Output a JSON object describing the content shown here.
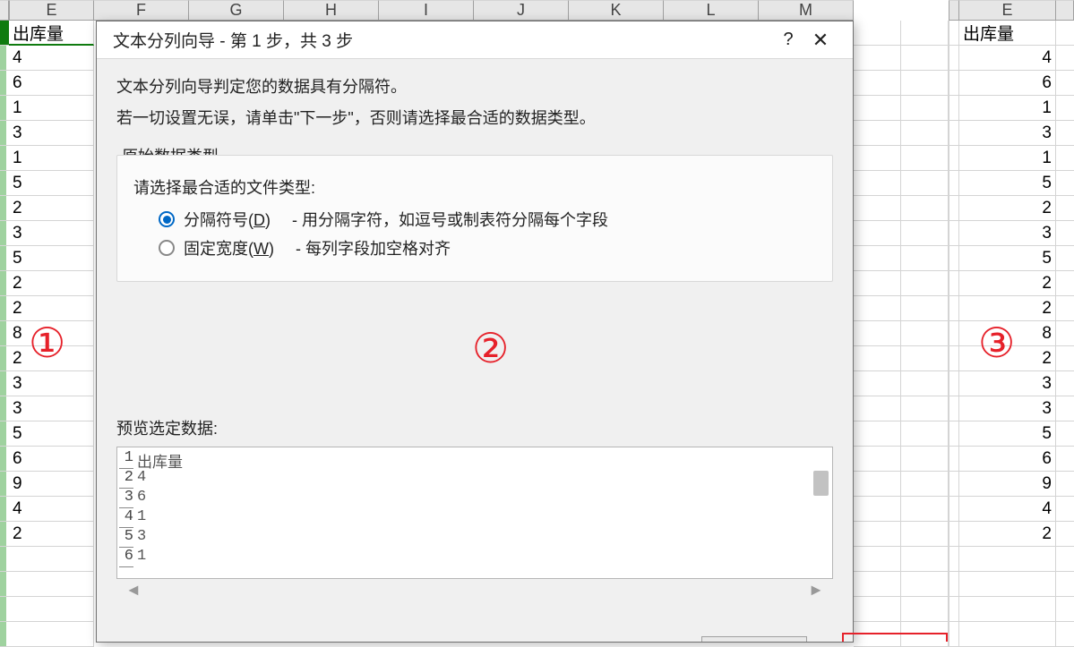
{
  "columns": {
    "E": "E",
    "F": "F",
    "G": "G",
    "H": "H",
    "I": "I",
    "J": "J",
    "K": "K",
    "L": "L",
    "M": "M"
  },
  "left_sheet": {
    "header": "出库量",
    "values": [
      "4",
      "6",
      "1",
      "3",
      "1",
      "5",
      "2",
      "3",
      "5",
      "2",
      "2",
      "8",
      "2",
      "3",
      "3",
      "5",
      "6",
      "9",
      "4",
      "2"
    ]
  },
  "right_sheet": {
    "col": "E",
    "header": "出库量",
    "values": [
      "4",
      "6",
      "1",
      "3",
      "1",
      "5",
      "2",
      "3",
      "5",
      "2",
      "2",
      "8",
      "2",
      "3",
      "3",
      "5",
      "6",
      "9",
      "4",
      "2"
    ]
  },
  "dialog": {
    "title": "文本分列向导 - 第 1 步，共 3 步",
    "help": "?",
    "line1": "文本分列向导判定您的数据具有分隔符。",
    "line2": "若一切设置无误，请单击\"下一步\"，否则请选择最合适的数据类型。",
    "fieldset_title": "原始数据类型",
    "fs_prompt": "请选择最合适的文件类型:",
    "opt1_label_pre": "分隔符号(",
    "opt1_label_u": "D",
    "opt1_label_post": ")",
    "opt1_desc": "- 用分隔字符，如逗号或制表符分隔每个字段",
    "opt2_label_pre": "固定宽度(",
    "opt2_label_u": "W",
    "opt2_label_post": ")",
    "opt2_desc": "- 每列字段加空格对齐",
    "preview_label": "预览选定数据:",
    "preview_lines": [
      {
        "n": "1",
        "v": "出库量"
      },
      {
        "n": "2",
        "v": "4"
      },
      {
        "n": "3",
        "v": "6"
      },
      {
        "n": "4",
        "v": "1"
      },
      {
        "n": "5",
        "v": "3"
      },
      {
        "n": "6",
        "v": "1"
      }
    ]
  },
  "annotations": {
    "c1": "①",
    "c2": "②",
    "c3": "③"
  },
  "scroll": {
    "left": "◄",
    "right": "►"
  }
}
